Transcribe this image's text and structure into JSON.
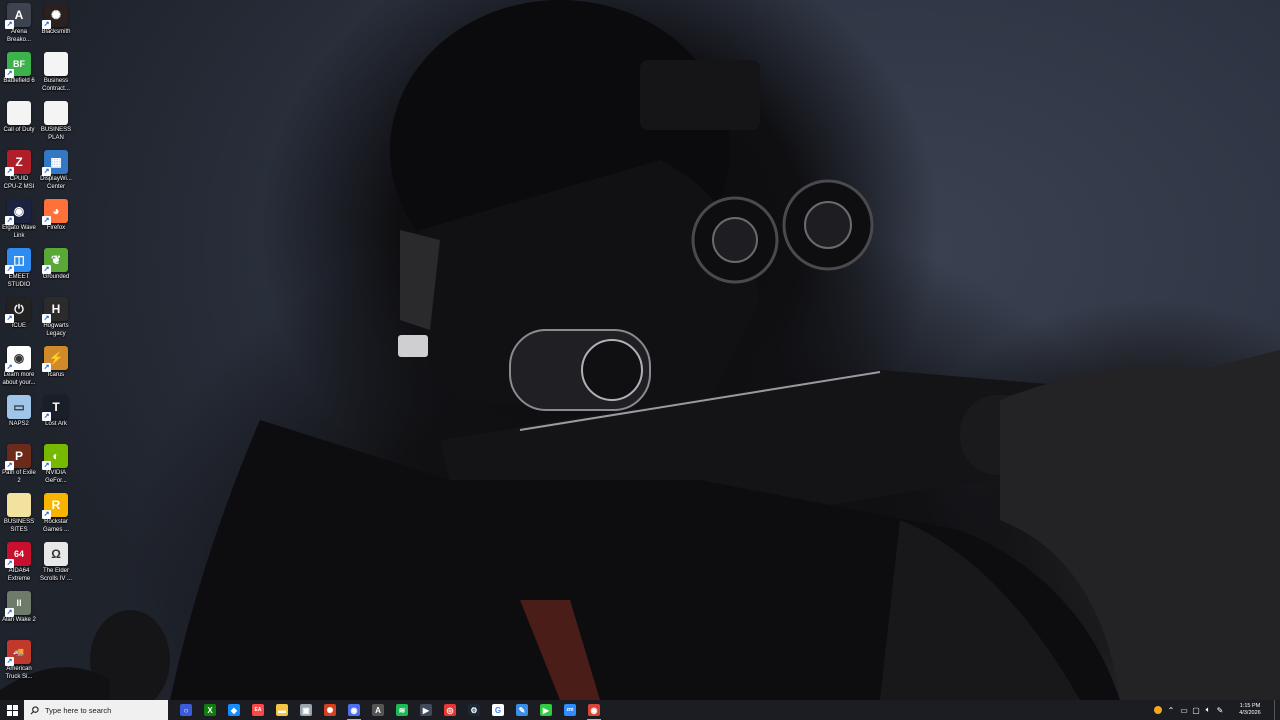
{
  "desktop": {
    "icons": [
      {
        "label": "Arena\nBreako...",
        "icon": "arena-breakout-icon",
        "color": "#3d4450",
        "glyph": "A"
      },
      {
        "label": "Blacksmith",
        "icon": "blacksmith-icon",
        "color": "#2a2020",
        "glyph": "✺"
      },
      {
        "label": "Battlefield 6",
        "icon": "battlefield-icon",
        "color": "#3bb34a",
        "glyph": "BF"
      },
      {
        "label": "Business\nContract...",
        "icon": "document-icon",
        "color": "#f4f4f4",
        "glyph": ""
      },
      {
        "label": "Call of Duty",
        "icon": "document-icon",
        "color": "#f4f4f4",
        "glyph": ""
      },
      {
        "label": "BUSINESS\nPLAN",
        "icon": "document-icon",
        "color": "#f4f4f4",
        "glyph": ""
      },
      {
        "label": "CPUID\nCPU-Z MSI",
        "icon": "cpuz-icon",
        "color": "#b01e2a",
        "glyph": "Z"
      },
      {
        "label": "DisplayWi...\nCenter",
        "icon": "display-widget-icon",
        "color": "#3477c4",
        "glyph": "▦"
      },
      {
        "label": "Elgato Wave\nLink",
        "icon": "elgato-wave-icon",
        "color": "#1c2340",
        "glyph": "◉"
      },
      {
        "label": "Firefox",
        "icon": "firefox-icon",
        "color": "#ff7139",
        "glyph": "◕"
      },
      {
        "label": "EMEET\nSTUDIO",
        "icon": "emeet-icon",
        "color": "#2e8bef",
        "glyph": "◫"
      },
      {
        "label": "Grounded",
        "icon": "grounded-icon",
        "color": "#5aa838",
        "glyph": "❦"
      },
      {
        "label": "iCUE",
        "icon": "icue-icon",
        "color": "#222",
        "glyph": "⏻"
      },
      {
        "label": "Hogwarts\nLegacy",
        "icon": "hogwarts-icon",
        "color": "#2b2b2b",
        "glyph": "H"
      },
      {
        "label": "Learn more\nabout your...",
        "icon": "chrome-icon",
        "color": "#ffffff",
        "glyph": "◉"
      },
      {
        "label": "Icarus",
        "icon": "icarus-icon",
        "color": "#d08a2a",
        "glyph": "⚡"
      },
      {
        "label": "NAPS2",
        "icon": "scanner-icon",
        "color": "#9fc6e8",
        "glyph": "▭"
      },
      {
        "label": "Lost Ark",
        "icon": "lost-ark-icon",
        "color": "#1a1e28",
        "glyph": "T"
      },
      {
        "label": "Path of Exile\n2",
        "icon": "path-of-exile-icon",
        "color": "#6b2a1a",
        "glyph": "P"
      },
      {
        "label": "NVIDIA\nGeFor...",
        "icon": "nvidia-icon",
        "color": "#76b900",
        "glyph": "◐"
      },
      {
        "label": "BUSINESS\nSITES",
        "icon": "folder-doc-icon",
        "color": "#f2e2a0",
        "glyph": ""
      },
      {
        "label": "Rockstar\nGames ...",
        "icon": "rockstar-icon",
        "color": "#f7b500",
        "glyph": "R"
      },
      {
        "label": "AIDA64\nExtreme",
        "icon": "aida64-icon",
        "color": "#c8102e",
        "glyph": "64"
      },
      {
        "label": "The Elder\nScrolls IV ...",
        "icon": "elder-scrolls-icon",
        "color": "#e8e8e8",
        "glyph": "Ω"
      },
      {
        "label": "Alan Wake 2",
        "icon": "alan-wake-icon",
        "color": "#6e7a6a",
        "glyph": "II"
      },
      {
        "label": "",
        "icon": "",
        "color": "",
        "glyph": ""
      },
      {
        "label": "American\nTruck Si...",
        "icon": "american-truck-icon",
        "color": "#c0392b",
        "glyph": "🚚"
      }
    ]
  },
  "taskbar": {
    "search_placeholder": "Type here to search",
    "apps": [
      {
        "icon": "cortana-icon",
        "color": "#3b5bdb",
        "glyph": "○",
        "active": false
      },
      {
        "icon": "xbox-icon",
        "color": "#107c10",
        "glyph": "X",
        "active": false
      },
      {
        "icon": "battlenet-icon",
        "color": "#148eff",
        "glyph": "◆",
        "active": false
      },
      {
        "icon": "ea-icon",
        "color": "#ff4747",
        "glyph": "EA",
        "active": false
      },
      {
        "icon": "file-explorer-icon",
        "color": "#f4c542",
        "glyph": "▬",
        "active": false
      },
      {
        "icon": "display-icon",
        "color": "#9aa4b0",
        "glyph": "▣",
        "active": false
      },
      {
        "icon": "blacksmith-icon",
        "color": "#d2421f",
        "glyph": "✺",
        "active": false
      },
      {
        "icon": "chrome-icon",
        "color": "#4f6ff0",
        "glyph": "◉",
        "active": true
      },
      {
        "icon": "game-icon",
        "color": "#555",
        "glyph": "A",
        "active": false
      },
      {
        "icon": "spotify-icon",
        "color": "#1db954",
        "glyph": "≋",
        "active": false
      },
      {
        "icon": "media-icon",
        "color": "#3f4a5c",
        "glyph": "▶",
        "active": false
      },
      {
        "icon": "recorder-icon",
        "color": "#e53935",
        "glyph": "◎",
        "active": false
      },
      {
        "icon": "steam-icon",
        "color": "#1b2838",
        "glyph": "⚙",
        "active": false
      },
      {
        "icon": "google-icon",
        "color": "#ffffff",
        "glyph": "G",
        "active": false
      },
      {
        "icon": "paint-icon",
        "color": "#3a8ee6",
        "glyph": "✎",
        "active": false
      },
      {
        "icon": "play-icon",
        "color": "#2ecc40",
        "glyph": "▶",
        "active": false
      },
      {
        "icon": "zoom-icon",
        "color": "#2d8cff",
        "glyph": "zm",
        "active": false
      },
      {
        "icon": "chrome-icon",
        "color": "#db4437",
        "glyph": "◉",
        "active": true
      }
    ],
    "tray": {
      "clock_time": "1:15 PM",
      "clock_date": "4/3/2026"
    }
  }
}
